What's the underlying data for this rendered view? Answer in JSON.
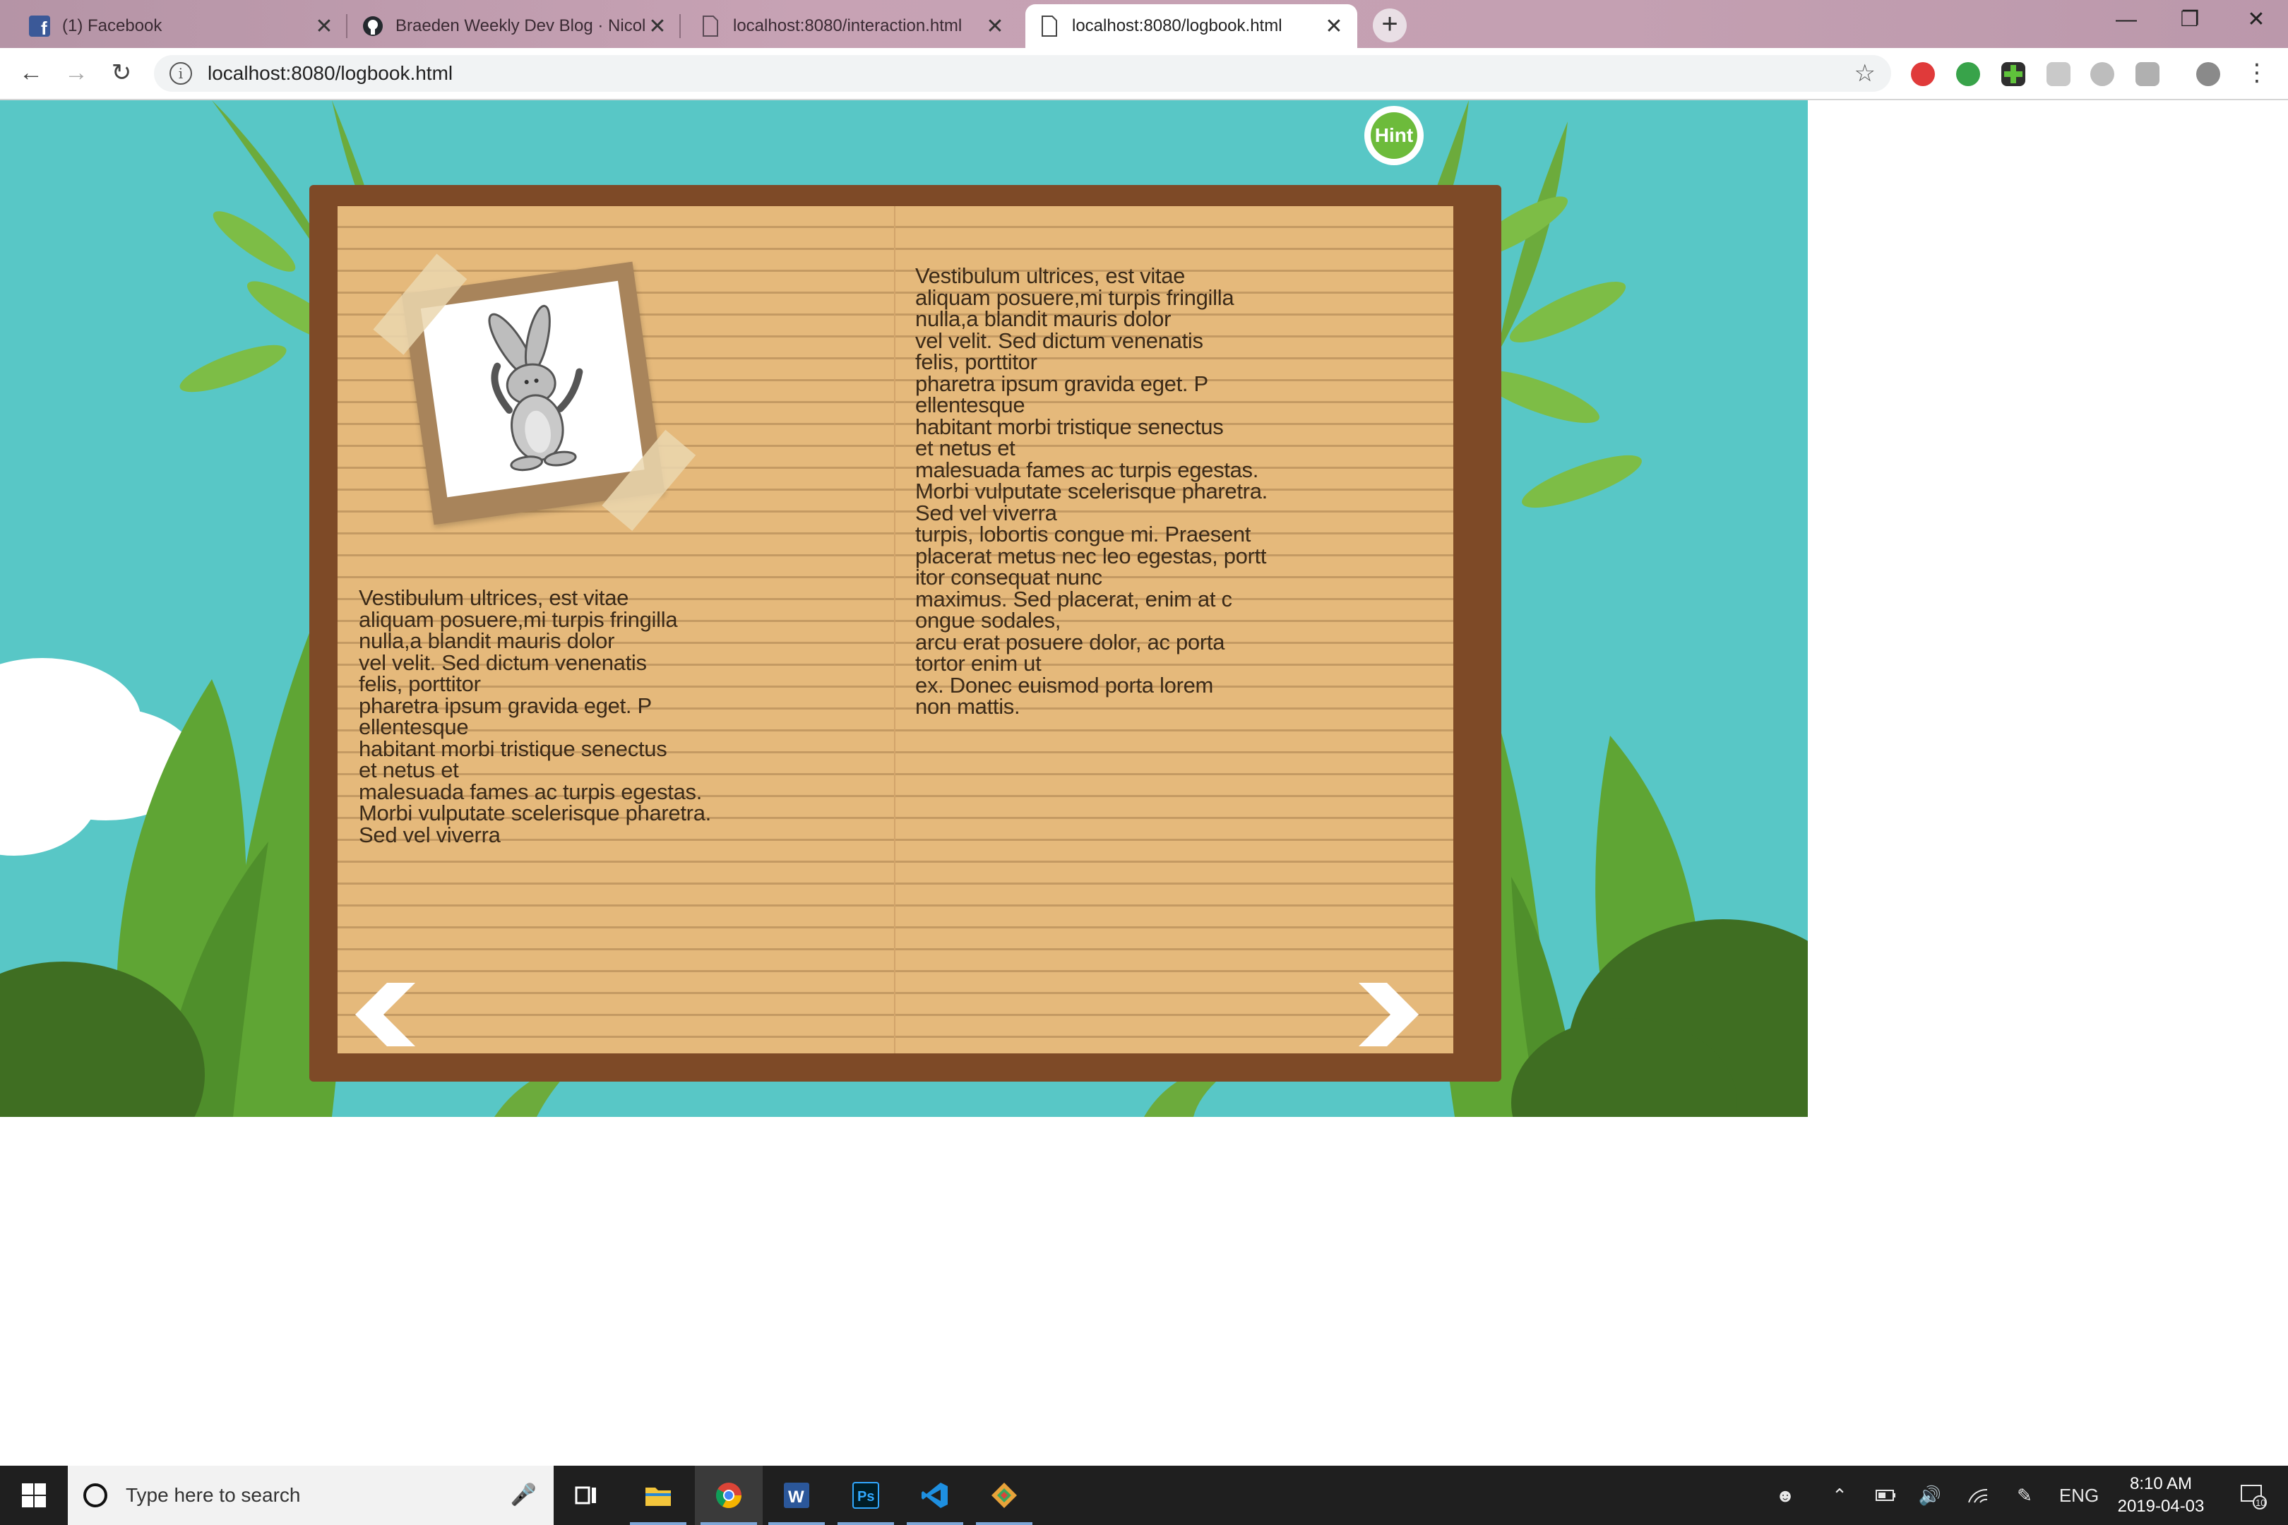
{
  "browser": {
    "tabs": [
      {
        "title": "(1) Facebook",
        "icon": "facebook-icon",
        "active": false
      },
      {
        "title": "Braeden Weekly Dev Blog · Nicol",
        "icon": "github-icon",
        "active": false
      },
      {
        "title": "localhost:8080/interaction.html",
        "icon": "page-icon",
        "active": false
      },
      {
        "title": "localhost:8080/logbook.html",
        "icon": "page-icon",
        "active": true
      }
    ],
    "new_tab_label": "+",
    "url": "localhost:8080/logbook.html",
    "close_glyph": "✕"
  },
  "logbook": {
    "hint_label": "Hint",
    "left_text": "Vestibulum ultrices, est vitae\naliquam posuere,mi turpis fringilla\nnulla,a blandit mauris dolor\nvel velit. Sed dictum venenatis\nfelis, porttitor\npharetra ipsum gravida eget. P\nellentesque\nhabitant morbi tristique senectus\net netus et\nmalesuada fames ac turpis egestas.\nMorbi vulputate scelerisque pharetra.\nSed vel viverra",
    "right_text": "Vestibulum ultrices, est vitae\naliquam posuere,mi turpis fringilla\nnulla,a blandit mauris dolor\nvel velit. Sed dictum venenatis\nfelis, porttitor\npharetra ipsum gravida eget. P\nellentesque\nhabitant morbi tristique senectus\net netus et\nmalesuada fames ac turpis egestas.\nMorbi vulputate scelerisque pharetra.\nSed vel viverra\nturpis, lobortis congue mi. Praesent\nplacerat metus nec leo egestas, portt\nitor consequat nunc\nmaximus. Sed placerat, enim at c\nongue sodales,\narcu erat posuere dolor, ac porta\ntortor enim ut\nex. Donec euismod porta lorem\nnon mattis.",
    "photo_subject": "dabbing-bunny",
    "prev_icon": "chevron-left-icon",
    "next_icon": "chevron-right-icon"
  },
  "taskbar": {
    "search_placeholder": "Type here to search",
    "apps": [
      "task-view-icon",
      "file-explorer-icon",
      "chrome-icon",
      "word-icon",
      "photoshop-icon",
      "vscode-icon",
      "git-icon"
    ],
    "language": "ENG",
    "time": "8:10 AM",
    "date": "2019-04-03",
    "notification_count": "10"
  },
  "colors": {
    "sky": "#58c7c6",
    "book_frame": "#7e4a27",
    "paper": "#e5b97b",
    "hint_green": "#6dbb3b"
  }
}
